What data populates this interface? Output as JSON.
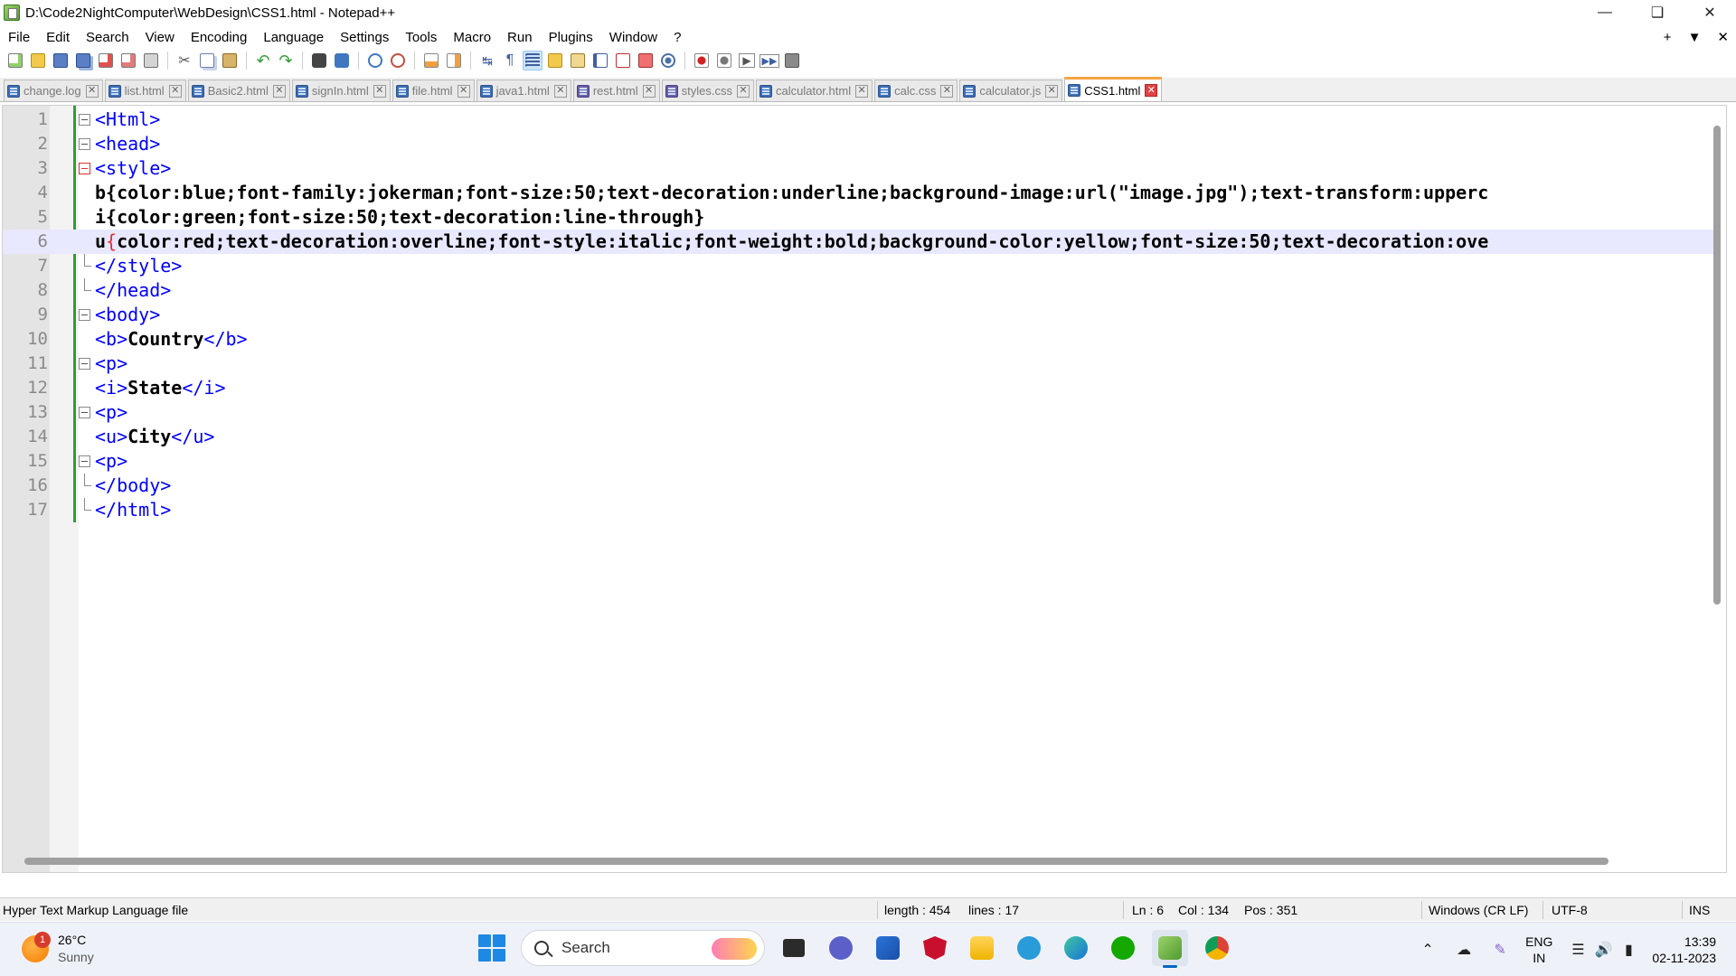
{
  "window": {
    "title": "D:\\Code2NightComputer\\WebDesign\\CSS1.html - Notepad++",
    "controls": [
      "minimize",
      "restore",
      "close"
    ]
  },
  "menu": {
    "items": [
      "File",
      "Edit",
      "Search",
      "View",
      "Encoding",
      "Language",
      "Settings",
      "Tools",
      "Macro",
      "Run",
      "Plugins",
      "Window",
      "?"
    ],
    "right": [
      "+",
      "▼",
      "✕"
    ]
  },
  "toolbar": {
    "icons": [
      "new-file-icon",
      "open-file-icon",
      "save-icon",
      "save-all-icon",
      "close-icon",
      "close-all-icon",
      "print-icon",
      "cut-icon",
      "copy-icon",
      "paste-icon",
      "undo-icon",
      "redo-icon",
      "find-icon",
      "replace-icon",
      "zoom-in-icon",
      "zoom-out-icon",
      "sync-vertical-icon",
      "sync-horizontal-icon",
      "word-wrap-icon",
      "show-all-chars-icon",
      "indent-guide-icon",
      "udl-icon",
      "doc-map-icon",
      "function-list-icon",
      "folder-workspace-icon",
      "monitoring-icon",
      "record-macro-icon",
      "stop-macro-icon",
      "play-macro-icon",
      "run-macro-multiple-icon",
      "save-macro-icon"
    ]
  },
  "tabs": [
    {
      "label": "change.log",
      "active": false
    },
    {
      "label": "list.html",
      "active": false
    },
    {
      "label": "Basic2.html",
      "active": false
    },
    {
      "label": "signIn.html",
      "active": false
    },
    {
      "label": "file.html",
      "active": false
    },
    {
      "label": "java1.html",
      "active": false
    },
    {
      "label": "rest.html",
      "active": false
    },
    {
      "label": "styles.css",
      "active": false
    },
    {
      "label": "calculator.html",
      "active": false
    },
    {
      "label": "calc.css",
      "active": false
    },
    {
      "label": "calculator.js",
      "active": false
    },
    {
      "label": "CSS1.html",
      "active": true
    }
  ],
  "editor": {
    "current_line": 6,
    "lines": [
      {
        "n": "1",
        "text": "<Html>"
      },
      {
        "n": "2",
        "text": "<head>"
      },
      {
        "n": "3",
        "text": "<style>"
      },
      {
        "n": "4",
        "text": "b{color:blue;font-family:jokerman;font-size:50;text-decoration:underline;background-image:url(\"image.jpg\");text-transform:upperc"
      },
      {
        "n": "5",
        "text": "i{color:green;font-size:50;text-decoration:line-through}"
      },
      {
        "n": "6",
        "text": "u{color:red;text-decoration:overline;font-style:italic;font-weight:bold;background-color:yellow;font-size:50;text-decoration:ove"
      },
      {
        "n": "7",
        "text": "</style>"
      },
      {
        "n": "8",
        "text": "</head>"
      },
      {
        "n": "9",
        "text": "<body>"
      },
      {
        "n": "10",
        "text": "<b>Country</b>"
      },
      {
        "n": "11",
        "text": "<p>"
      },
      {
        "n": "12",
        "text": "<i>State</i>"
      },
      {
        "n": "13",
        "text": "<p>"
      },
      {
        "n": "14",
        "text": "<u>City</u>"
      },
      {
        "n": "15",
        "text": "<p>"
      },
      {
        "n": "16",
        "text": "</body>"
      },
      {
        "n": "17",
        "text": "</html>"
      }
    ]
  },
  "status": {
    "file_type": "Hyper Text Markup Language file",
    "length": "length : 454",
    "lines": "lines : 17",
    "ln": "Ln : 6",
    "col": "Col : 134",
    "pos": "Pos : 351",
    "eol": "Windows (CR LF)",
    "encoding": "UTF-8",
    "mode": "INS"
  },
  "taskbar": {
    "weather_temp": "26°C",
    "weather_desc": "Sunny",
    "weather_badge": "1",
    "search_label": "Search",
    "apps": [
      "file-explorer-icon",
      "teams-chat-icon",
      "microsoft-store-icon",
      "mcafee-icon",
      "folder-icon",
      "help-icon",
      "edge-icon",
      "upwork-icon",
      "notepadpp-icon",
      "chrome-icon"
    ],
    "lang_top": "ENG",
    "lang_bottom": "IN",
    "time": "13:39",
    "date": "02-11-2023"
  },
  "colors": {
    "tag": "#0000ff",
    "text": "#000000",
    "current_line": "#e8e8ff",
    "active_tab_accent": "#f5a340",
    "fold_bar": "#2ca02c"
  }
}
